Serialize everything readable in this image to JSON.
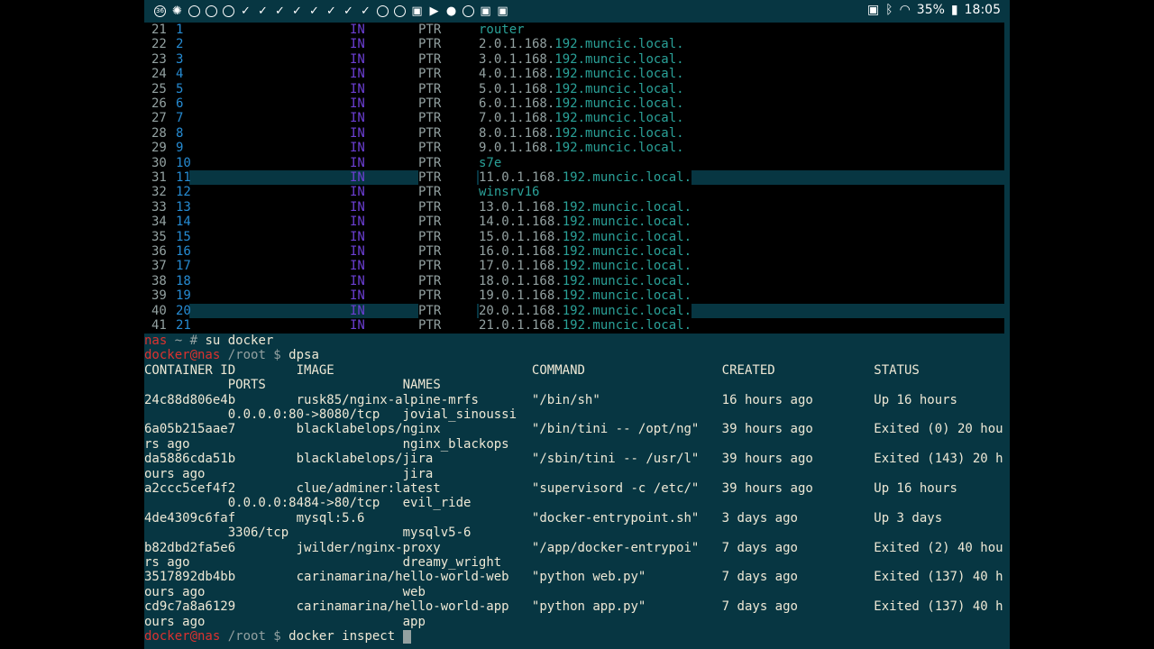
{
  "statusbar": {
    "left_icons": [
      "badge-36-icon",
      "bug-icon",
      "chat-icon",
      "chat-icon",
      "chat-icon",
      "check-icon",
      "check-icon",
      "check-icon",
      "check-icon",
      "check-icon",
      "check-icon",
      "check-icon",
      "check-icon",
      "chat-icon",
      "chat-icon",
      "image-icon",
      "play-icon",
      "droplet-icon",
      "github-icon",
      "image-icon",
      "image-icon"
    ],
    "right": {
      "battery": "35%",
      "time": "18:05"
    }
  },
  "vim": {
    "lines": [
      {
        "n": "21",
        "rec": "1",
        "cls": "IN",
        "type": "PTR",
        "host": "router",
        "domain": "",
        "hl": false
      },
      {
        "n": "22",
        "rec": "2",
        "cls": "IN",
        "type": "PTR",
        "host": "2.0.1.168.",
        "domain": "192.muncic.local.",
        "hl": false
      },
      {
        "n": "23",
        "rec": "3",
        "cls": "IN",
        "type": "PTR",
        "host": "3.0.1.168.",
        "domain": "192.muncic.local.",
        "hl": false
      },
      {
        "n": "24",
        "rec": "4",
        "cls": "IN",
        "type": "PTR",
        "host": "4.0.1.168.",
        "domain": "192.muncic.local.",
        "hl": false
      },
      {
        "n": "25",
        "rec": "5",
        "cls": "IN",
        "type": "PTR",
        "host": "5.0.1.168.",
        "domain": "192.muncic.local.",
        "hl": false
      },
      {
        "n": "26",
        "rec": "6",
        "cls": "IN",
        "type": "PTR",
        "host": "6.0.1.168.",
        "domain": "192.muncic.local.",
        "hl": false
      },
      {
        "n": "27",
        "rec": "7",
        "cls": "IN",
        "type": "PTR",
        "host": "7.0.1.168.",
        "domain": "192.muncic.local.",
        "hl": false
      },
      {
        "n": "28",
        "rec": "8",
        "cls": "IN",
        "type": "PTR",
        "host": "8.0.1.168.",
        "domain": "192.muncic.local.",
        "hl": false
      },
      {
        "n": "29",
        "rec": "9",
        "cls": "IN",
        "type": "PTR",
        "host": "9.0.1.168.",
        "domain": "192.muncic.local.",
        "hl": false
      },
      {
        "n": "30",
        "rec": "10",
        "cls": "IN",
        "type": "PTR",
        "host": "s7e",
        "domain": "",
        "hl": false
      },
      {
        "n": "31",
        "rec": "11",
        "cls": "IN",
        "type": "PTR",
        "host": "11.0.1.168.",
        "domain": "192.muncic.local.",
        "hl": true
      },
      {
        "n": "32",
        "rec": "12",
        "cls": "IN",
        "type": "PTR",
        "host": "winsrv16",
        "domain": "",
        "hl": false
      },
      {
        "n": "33",
        "rec": "13",
        "cls": "IN",
        "type": "PTR",
        "host": "13.0.1.168.",
        "domain": "192.muncic.local.",
        "hl": false
      },
      {
        "n": "34",
        "rec": "14",
        "cls": "IN",
        "type": "PTR",
        "host": "14.0.1.168.",
        "domain": "192.muncic.local.",
        "hl": false
      },
      {
        "n": "35",
        "rec": "15",
        "cls": "IN",
        "type": "PTR",
        "host": "15.0.1.168.",
        "domain": "192.muncic.local.",
        "hl": false
      },
      {
        "n": "36",
        "rec": "16",
        "cls": "IN",
        "type": "PTR",
        "host": "16.0.1.168.",
        "domain": "192.muncic.local.",
        "hl": false
      },
      {
        "n": "37",
        "rec": "17",
        "cls": "IN",
        "type": "PTR",
        "host": "17.0.1.168.",
        "domain": "192.muncic.local.",
        "hl": false
      },
      {
        "n": "38",
        "rec": "18",
        "cls": "IN",
        "type": "PTR",
        "host": "18.0.1.168.",
        "domain": "192.muncic.local.",
        "hl": false
      },
      {
        "n": "39",
        "rec": "19",
        "cls": "IN",
        "type": "PTR",
        "host": "19.0.1.168.",
        "domain": "192.muncic.local.",
        "hl": false
      },
      {
        "n": "40",
        "rec": "20",
        "cls": "IN",
        "type": "PTR",
        "host": "20.0.1.168.",
        "domain": "192.muncic.local.",
        "hl": true
      },
      {
        "n": "41",
        "rec": "21",
        "cls": "IN",
        "type": "PTR",
        "host": "21.0.1.168.",
        "domain": "192.muncic.local.",
        "hl": false
      }
    ]
  },
  "shell": {
    "prompt_root": {
      "user": "nas",
      "rest": " ~ # ",
      "cmd": "su docker"
    },
    "prompt_docker1": {
      "user": "docker@nas",
      "rest": " /root $ ",
      "cmd": "dpsa"
    },
    "headers": {
      "container_id": "CONTAINER ID",
      "image": "IMAGE",
      "command": "COMMAND",
      "created": "CREATED",
      "status": "STATUS",
      "ports": "PORTS",
      "names": "NAMES"
    },
    "containers": [
      {
        "id": "24c88d806e4b",
        "image": "rusk85/nginx-alpine-mrfs",
        "command": "\"/bin/sh\"",
        "created": "16 hours ago",
        "status": "Up 16 hours",
        "wrap": "",
        "ports": "0.0.0.0:80->8080/tcp",
        "names": "jovial_sinoussi"
      },
      {
        "id": "6a05b215aae7",
        "image": "blacklabelops/nginx",
        "command": "\"/bin/tini -- /opt/ng\"",
        "created": "39 hours ago",
        "status": "Exited (0) 20 hou",
        "wrap": "rs ago",
        "ports": "",
        "names": "nginx_blackops"
      },
      {
        "id": "da5886cda51b",
        "image": "blacklabelops/jira",
        "command": "\"/sbin/tini -- /usr/l\"",
        "created": "39 hours ago",
        "status": "Exited (143) 20 h",
        "wrap": "ours ago",
        "ports": "",
        "names": "jira"
      },
      {
        "id": "a2ccc5cef4f2",
        "image": "clue/adminer:latest",
        "command": "\"supervisord -c /etc/\"",
        "created": "39 hours ago",
        "status": "Up 16 hours",
        "wrap": "",
        "ports": "0.0.0.0:8484->80/tcp",
        "names": "evil_ride"
      },
      {
        "id": "4de4309c6faf",
        "image": "mysql:5.6",
        "command": "\"docker-entrypoint.sh\"",
        "created": "3 days ago",
        "status": "Up 3 days",
        "wrap": "",
        "ports": "3306/tcp",
        "names": "mysqlv5-6"
      },
      {
        "id": "b82dbd2fa5e6",
        "image": "jwilder/nginx-proxy",
        "command": "\"/app/docker-entrypoi\"",
        "created": "7 days ago",
        "status": "Exited (2) 40 hou",
        "wrap": "rs ago",
        "ports": "",
        "names": "dreamy_wright"
      },
      {
        "id": "3517892db4bb",
        "image": "carinamarina/hello-world-web",
        "command": "\"python web.py\"",
        "created": "7 days ago",
        "status": "Exited (137) 40 h",
        "wrap": "ours ago",
        "ports": "",
        "names": "web"
      },
      {
        "id": "cd9c7a8a6129",
        "image": "carinamarina/hello-world-app",
        "command": "\"python app.py\"",
        "created": "7 days ago",
        "status": "Exited (137) 40 h",
        "wrap": "ours ago",
        "ports": "",
        "names": "app"
      }
    ],
    "prompt_docker2": {
      "user": "docker@nas",
      "rest": " /root $ ",
      "cmd": "docker inspect "
    }
  }
}
